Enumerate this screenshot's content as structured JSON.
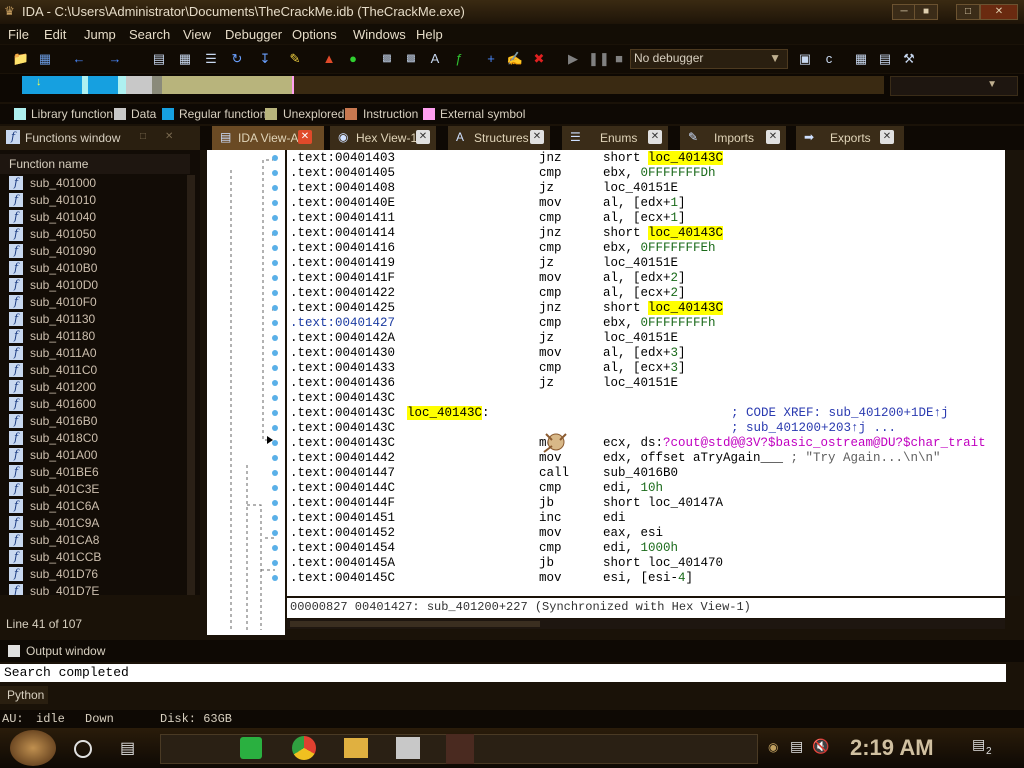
{
  "window": {
    "title": "IDA - C:\\Users\\Administrator\\Documents\\TheCrackMe.idb (TheCrackMe.exe)"
  },
  "menu": [
    "File",
    "Edit",
    "Jump",
    "Search",
    "View",
    "Debugger",
    "Options",
    "Windows",
    "Help"
  ],
  "toolbar": {
    "debugger_select": "No debugger"
  },
  "legend": [
    {
      "label": "Library function",
      "color": "#aef0f0"
    },
    {
      "label": "Data",
      "color": "#c8c8c8"
    },
    {
      "label": "Regular function",
      "color": "#16a0e0"
    },
    {
      "label": "Unexplored",
      "color": "#b8b47c"
    },
    {
      "label": "Instruction",
      "color": "#c87850"
    },
    {
      "label": "External symbol",
      "color": "#ff9ff0"
    }
  ],
  "functions_window": {
    "title": "Functions window",
    "column_header": "Function name",
    "items": [
      "sub_401000",
      "sub_401010",
      "sub_401040",
      "sub_401050",
      "sub_401090",
      "sub_4010B0",
      "sub_4010D0",
      "sub_4010F0",
      "sub_401130",
      "sub_401180",
      "sub_4011A0",
      "sub_4011C0",
      "sub_401200",
      "sub_401600",
      "sub_4016B0",
      "sub_4018C0",
      "sub_401A00",
      "sub_401BE6",
      "sub_401C3E",
      "sub_401C6A",
      "sub_401C9A",
      "sub_401CA8",
      "sub_401CCB",
      "sub_401D76",
      "sub_401D7E"
    ],
    "status": "Line 41 of 107"
  },
  "tabs": [
    {
      "label": "IDA View-A",
      "active": true
    },
    {
      "label": "Hex View-1",
      "active": false
    },
    {
      "label": "Structures",
      "active": false
    },
    {
      "label": "Enums",
      "active": false
    },
    {
      "label": "Imports",
      "active": false
    },
    {
      "label": "Exports",
      "active": false
    }
  ],
  "disassembly": [
    {
      "addr": ".text:00401403",
      "mn": "jnz",
      "op": "short ",
      "lbl": "loc_40143C"
    },
    {
      "addr": ".text:00401405",
      "mn": "cmp",
      "op": "ebx, ",
      "num": "0FFFFFFFDh"
    },
    {
      "addr": ".text:00401408",
      "mn": "jz",
      "op": "loc_40151E"
    },
    {
      "addr": ".text:0040140E",
      "mn": "mov",
      "op": "al, [edx+",
      "num": "1",
      "tail": "]"
    },
    {
      "addr": ".text:00401411",
      "mn": "cmp",
      "op": "al, [ecx+",
      "num": "1",
      "tail": "]"
    },
    {
      "addr": ".text:00401414",
      "mn": "jnz",
      "op": "short ",
      "lbl": "loc_40143C"
    },
    {
      "addr": ".text:00401416",
      "mn": "cmp",
      "op": "ebx, ",
      "num": "0FFFFFFFEh"
    },
    {
      "addr": ".text:00401419",
      "mn": "jz",
      "op": "loc_40151E"
    },
    {
      "addr": ".text:0040141F",
      "mn": "mov",
      "op": "al, [edx+",
      "num": "2",
      "tail": "]"
    },
    {
      "addr": ".text:00401422",
      "mn": "cmp",
      "op": "al, [ecx+",
      "num": "2",
      "tail": "]"
    },
    {
      "addr": ".text:00401425",
      "mn": "jnz",
      "op": "short ",
      "lbl": "loc_40143C"
    },
    {
      "addr": ".text:00401427",
      "mn": "cmp",
      "op": "ebx, ",
      "num": "0FFFFFFFFh",
      "cur": true
    },
    {
      "addr": ".text:0040142A",
      "mn": "jz",
      "op": "loc_40151E"
    },
    {
      "addr": ".text:00401430",
      "mn": "mov",
      "op": "al, [edx+",
      "num": "3",
      "tail": "]"
    },
    {
      "addr": ".text:00401433",
      "mn": "cmp",
      "op": "al, [ecx+",
      "num": "3",
      "tail": "]"
    },
    {
      "addr": ".text:00401436",
      "mn": "jz",
      "op": "loc_40151E"
    },
    {
      "addr": ".text:0040143C",
      "mn": "",
      "op": ""
    },
    {
      "addr": ".text:0040143C",
      "label": "loc_40143C",
      "colon": ":",
      "comment": "; CODE XREF: sub_401200+1DE↑j"
    },
    {
      "addr": ".text:0040143C",
      "mn": "",
      "op": "",
      "comment": "; sub_401200+203↑j ..."
    },
    {
      "addr": ".text:0040143C",
      "mn": "mov",
      "op": "ecx, ds:",
      "imp": "?cout@std@@3V?$basic_ostream@DU?$char_trait"
    },
    {
      "addr": ".text:00401442",
      "mn": "mov",
      "op": "edx, offset aTryAgain___ ",
      "cmt": "; \"Try Again...\\n\\n\""
    },
    {
      "addr": ".text:00401447",
      "mn": "call",
      "op": "sub_4016B0"
    },
    {
      "addr": ".text:0040144C",
      "mn": "cmp",
      "op": "edi, ",
      "num": "10h"
    },
    {
      "addr": ".text:0040144F",
      "mn": "jb",
      "op": "short loc_40147A"
    },
    {
      "addr": ".text:00401451",
      "mn": "inc",
      "op": "edi"
    },
    {
      "addr": ".text:00401452",
      "mn": "mov",
      "op": "eax, esi"
    },
    {
      "addr": ".text:00401454",
      "mn": "cmp",
      "op": "edi, ",
      "num": "1000h"
    },
    {
      "addr": ".text:0040145A",
      "mn": "jb",
      "op": "short loc_401470"
    },
    {
      "addr": ".text:0040145C",
      "mn": "mov",
      "op": "esi, [esi-",
      "num": "4",
      "tail": "]"
    }
  ],
  "disasm_status": "00000827 00401427: sub_401200+227 (Synchronized with Hex View-1)",
  "output_window": {
    "title": "Output window",
    "text": "Search completed",
    "tab": "Python"
  },
  "status_bar": {
    "au": "AU:",
    "state": "idle",
    "direction": "Down",
    "disk": "Disk: 63GB"
  },
  "taskbar": {
    "clock": "2:19 AM",
    "notification_count": "2"
  }
}
